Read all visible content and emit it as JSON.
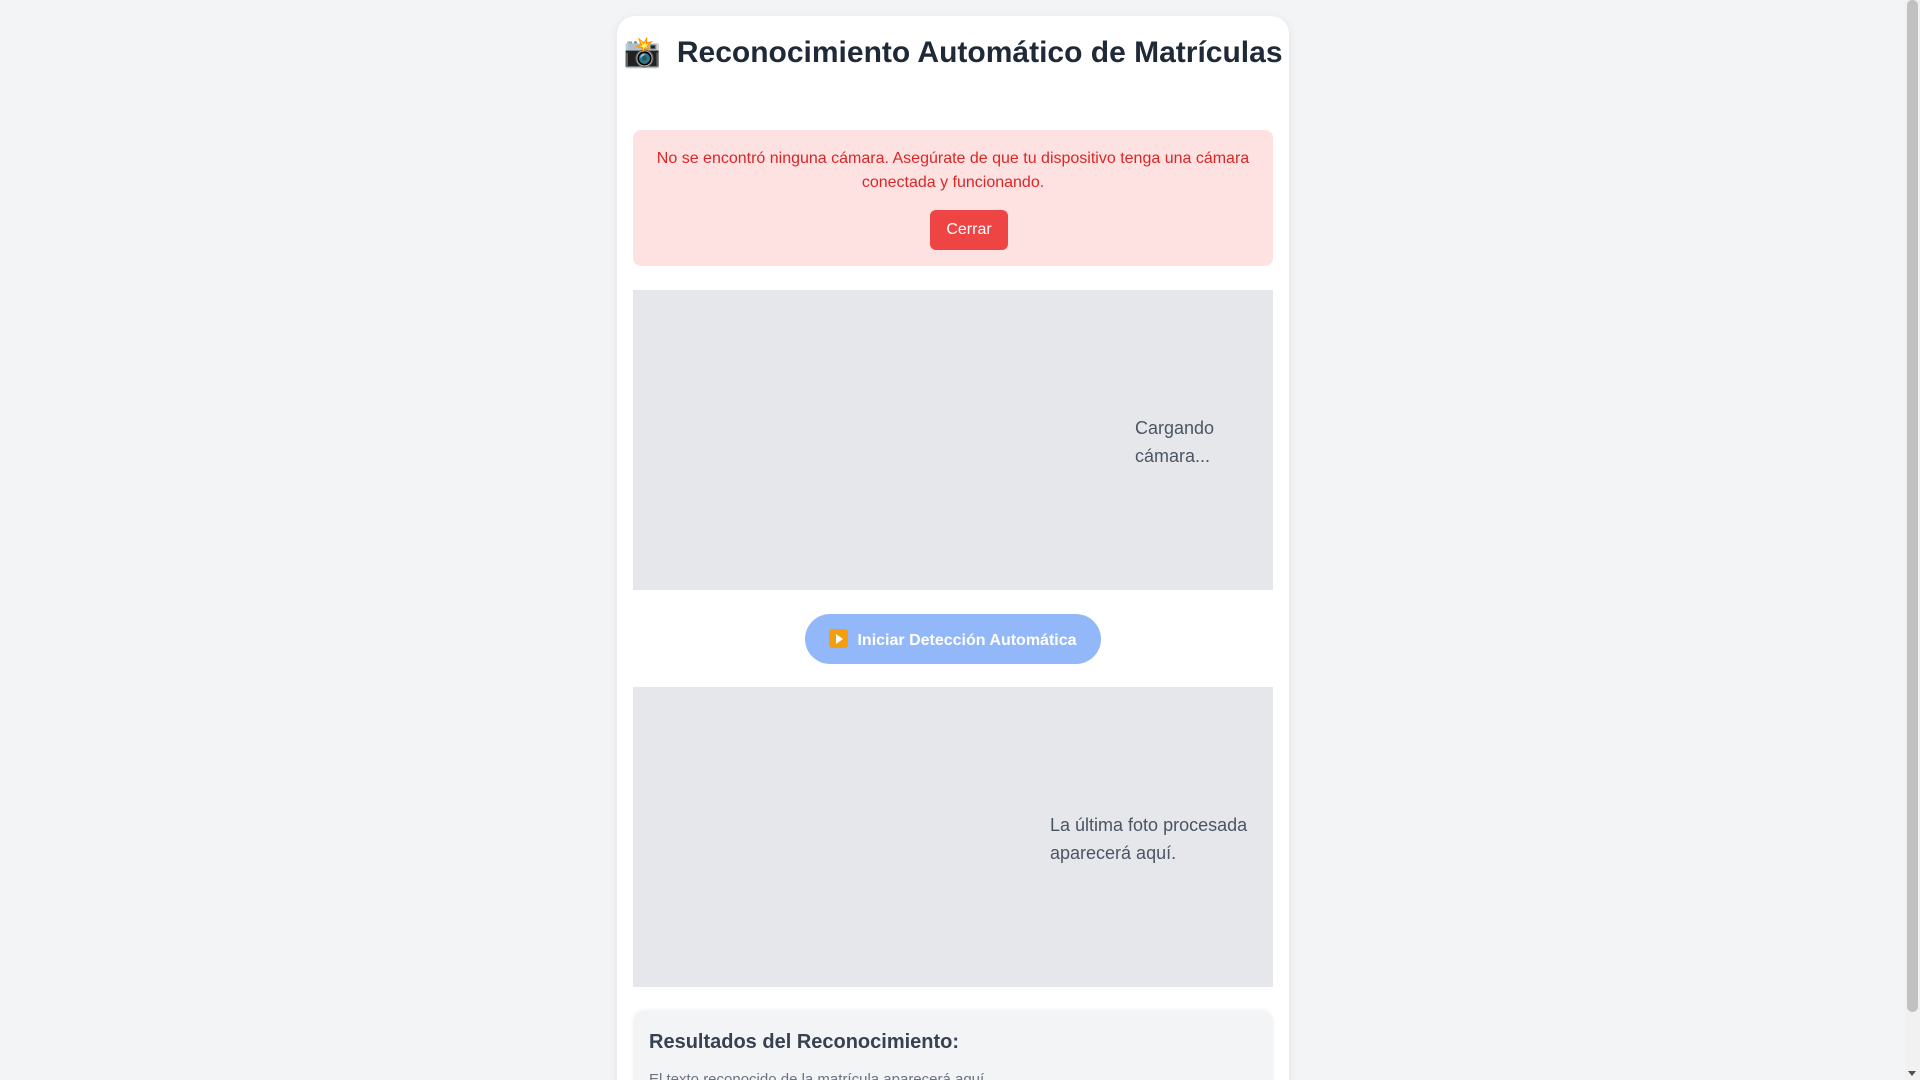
{
  "header": {
    "icon": "camera-flash-icon",
    "icon_glyph": "📸",
    "title": "Reconocimiento Automático de Matrículas"
  },
  "alert": {
    "message": "No se encontró ninguna cámara. Asegúrate de que tu dispositivo tenga una cámara conectada y funcionando.",
    "close_label": "Cerrar"
  },
  "camera": {
    "placeholder": "Cargando cámara..."
  },
  "controls": {
    "start_icon": "play-icon",
    "start_label": "Iniciar Detección Automática"
  },
  "last_photo": {
    "placeholder": "La última foto procesada aparecerá aquí."
  },
  "results": {
    "title": "Resultados del Reconocimiento:",
    "description": "El texto reconocido de la matrícula aparecerá aquí."
  },
  "colors": {
    "background": "#f3f4f6",
    "alert_bg": "#fee2e2",
    "alert_text": "#dc2626",
    "close_button": "#ef4444",
    "start_button": "#93b8f9",
    "placeholder_bg": "#e5e7eb"
  }
}
